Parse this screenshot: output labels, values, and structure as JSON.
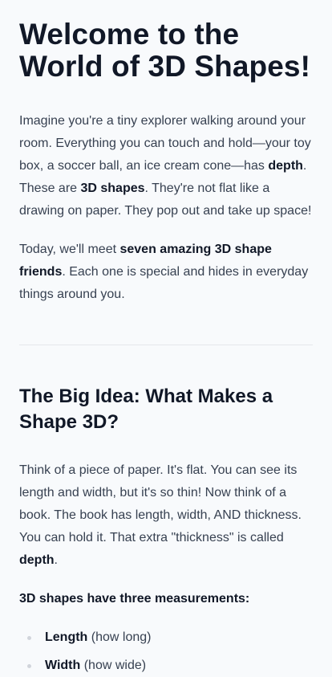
{
  "title": "Welcome to the World of 3D Shapes!",
  "intro": {
    "p1": {
      "t1": "Imagine you're a tiny explorer walking around your room. Everything you can touch and hold—your toy box, a soccer ball, an ice cream cone—has ",
      "b1": "depth",
      "t2": ". These are ",
      "b2": "3D shapes",
      "t3": ". They're not flat like a drawing on paper. They pop out and take up space!"
    },
    "p2": {
      "t1": "Today, we'll meet ",
      "b1": "seven amazing 3D shape friends",
      "t2": ". Each one is special and hides in everyday things around you."
    }
  },
  "section1": {
    "heading": "The Big Idea: What Makes a Shape 3D?",
    "p1": {
      "t1": "Think of a piece of paper. It's flat. You can see its length and width, but it's so thin! Now think of a book. The book has length, width, AND thickness. You can hold it. That extra \"thickness\" is called ",
      "b1": "depth",
      "t2": "."
    },
    "lead": "3D shapes have three measurements:",
    "measurements": [
      {
        "term": "Length",
        "desc": " (how long)"
      },
      {
        "term": "Width",
        "desc": " (how wide)"
      }
    ]
  }
}
